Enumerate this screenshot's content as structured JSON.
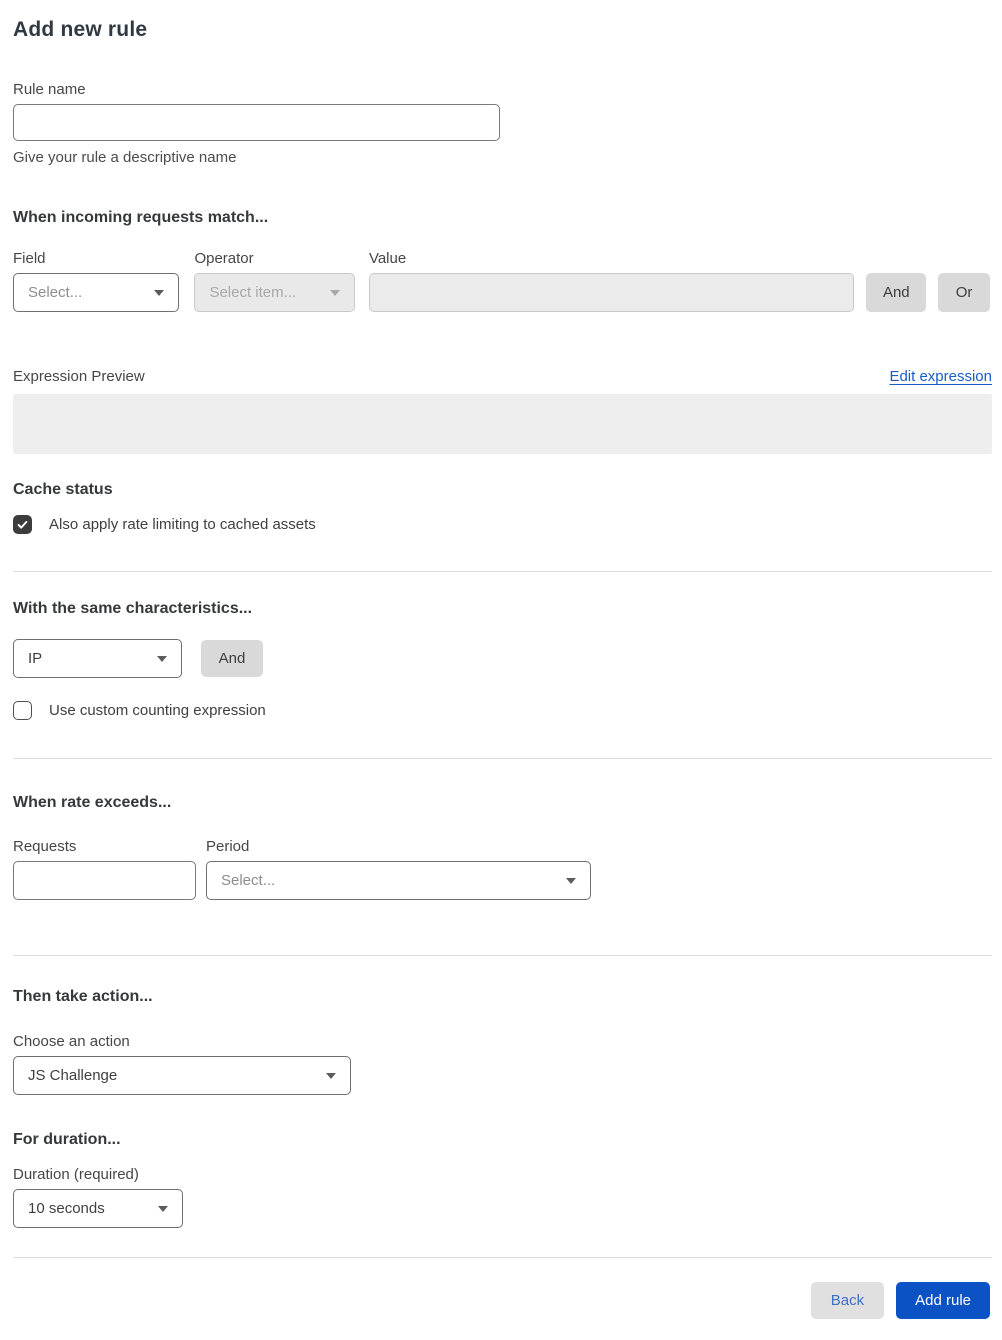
{
  "page": {
    "title": "Add new rule"
  },
  "rule_name": {
    "label": "Rule name",
    "value": "",
    "helper": "Give your rule a descriptive name"
  },
  "match": {
    "heading": "When incoming requests match...",
    "field": {
      "label": "Field",
      "selected": "Select..."
    },
    "operator": {
      "label": "Operator",
      "selected": "Select item..."
    },
    "value": {
      "label": "Value",
      "value": ""
    },
    "and_label": "And",
    "or_label": "Or"
  },
  "expression": {
    "label": "Expression Preview",
    "edit_link": "Edit expression",
    "preview_value": ""
  },
  "cache": {
    "heading": "Cache status",
    "checkbox_label": "Also apply rate limiting to cached assets",
    "checked": true
  },
  "characteristics": {
    "heading": "With the same characteristics...",
    "selected": "IP",
    "and_label": "And",
    "checkbox_label": "Use custom counting expression",
    "checked": false
  },
  "rate": {
    "heading": "When rate exceeds...",
    "requests": {
      "label": "Requests",
      "value": ""
    },
    "period": {
      "label": "Period",
      "selected": "Select..."
    }
  },
  "action": {
    "heading": "Then take action...",
    "label": "Choose an action",
    "selected": "JS Challenge"
  },
  "duration": {
    "heading": "For duration...",
    "label": "Duration (required)",
    "selected": "10 seconds"
  },
  "footer": {
    "back_label": "Back",
    "submit_label": "Add rule"
  },
  "colors": {
    "primary_blue": "#0b52c4",
    "link_blue": "#1a5cc8",
    "checkbox_dark": "#3c3c3c",
    "disabled_gray": "#e9e9e9",
    "button_gray": "#d9d9d9"
  }
}
